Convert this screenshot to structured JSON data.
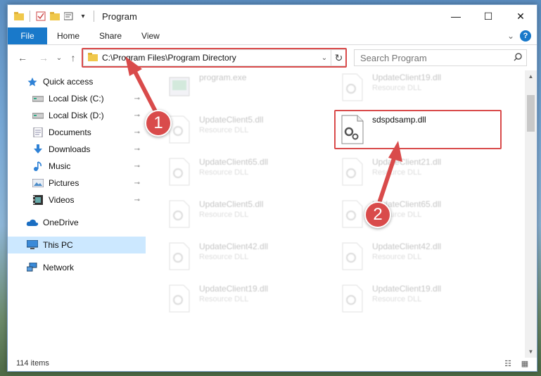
{
  "window": {
    "title": "Program",
    "minimize_glyph": "—",
    "maximize_glyph": "☐",
    "close_glyph": "✕"
  },
  "ribbon": {
    "file_tab": "File",
    "tabs": [
      "Home",
      "Share",
      "View"
    ],
    "expand_glyph": "⌄",
    "help_glyph": "?"
  },
  "address": {
    "path": "C:\\Program Files\\Program Directory",
    "back_glyph": "←",
    "forward_glyph": "→",
    "recent_glyph": "⌄",
    "up_glyph": "↑",
    "dropdown_glyph": "⌄",
    "refresh_glyph": "↻"
  },
  "search": {
    "placeholder": "Search Program",
    "icon": "search-icon"
  },
  "sidebar": {
    "quick_access": "Quick access",
    "items": [
      {
        "label": "Local Disk (C:)",
        "icon": "drive-icon"
      },
      {
        "label": "Local Disk (D:)",
        "icon": "drive-icon"
      },
      {
        "label": "Documents",
        "icon": "documents-icon"
      },
      {
        "label": "Downloads",
        "icon": "downloads-icon"
      },
      {
        "label": "Music",
        "icon": "music-icon"
      },
      {
        "label": "Pictures",
        "icon": "pictures-icon"
      },
      {
        "label": "Videos",
        "icon": "videos-icon"
      }
    ],
    "onedrive": "OneDrive",
    "this_pc": "This PC",
    "network": "Network",
    "pin_glyph": "📌"
  },
  "files": {
    "left_column": [
      {
        "name": "program.exe",
        "type": ""
      },
      {
        "name": "UpdateClient5.dll",
        "type": "Resource DLL"
      },
      {
        "name": "UpdateClient65.dll",
        "type": "Resource DLL"
      },
      {
        "name": "UpdateClient5.dll",
        "type": "Resource DLL"
      },
      {
        "name": "UpdateClient42.dll",
        "type": "Resource DLL"
      },
      {
        "name": "UpdateClient19.dll",
        "type": "Resource DLL"
      }
    ],
    "right_column": [
      {
        "name": "UpdateClient19.dll",
        "type": "Resource DLL"
      },
      {
        "name": "sdspdsamp.dll",
        "type": ""
      },
      {
        "name": "UpdateClient21.dll",
        "type": "Resource DLL"
      },
      {
        "name": "UpdateClient65.dll",
        "type": "Resource DLL"
      },
      {
        "name": "UpdateClient42.dll",
        "type": "Resource DLL"
      },
      {
        "name": "UpdateClient19.dll",
        "type": "Resource DLL"
      }
    ]
  },
  "status": {
    "item_count": "114 items"
  },
  "annotations": {
    "step1": "1",
    "step2": "2",
    "color": "#d94b4b"
  },
  "colors": {
    "accent": "#1979ca",
    "selected": "#cce8ff",
    "highlight": "#d94b4b"
  }
}
